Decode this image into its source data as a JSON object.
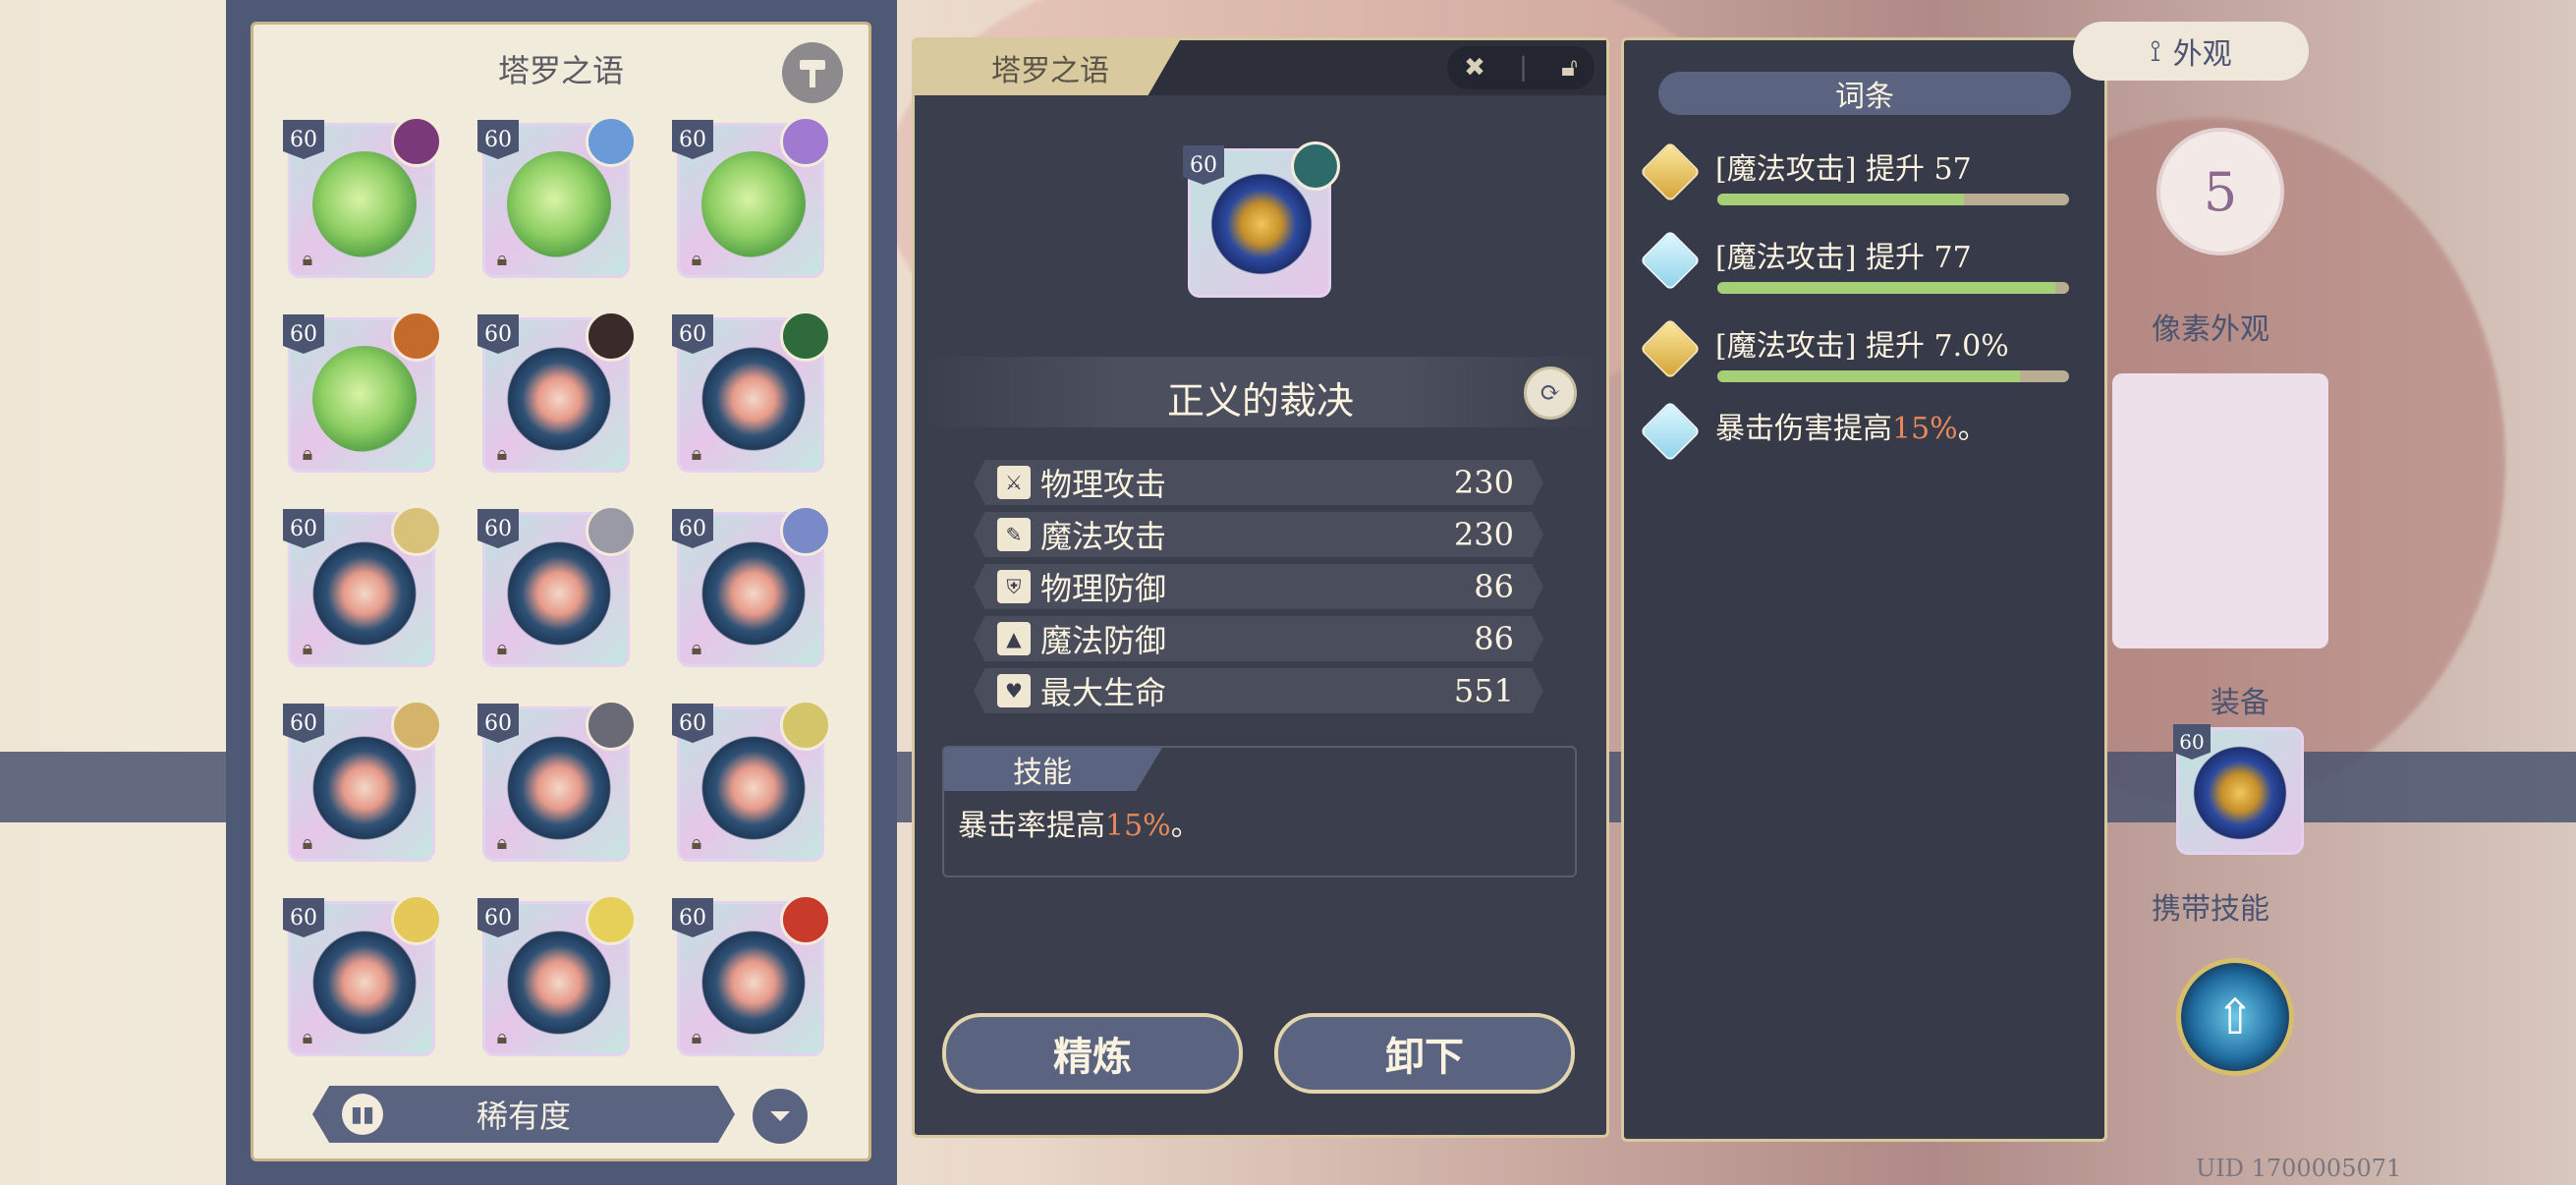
{
  "inventory": {
    "title": "塔罗之语",
    "sort_label": "稀有度",
    "cards": [
      {
        "level": "60",
        "art": "green",
        "owner_color": "#7a3a7a"
      },
      {
        "level": "60",
        "art": "green",
        "owner_color": "#6a9ad8"
      },
      {
        "level": "60",
        "art": "green",
        "owner_color": "#a07ad0"
      },
      {
        "level": "60",
        "art": "green",
        "owner_color": "#c46a2a"
      },
      {
        "level": "60",
        "art": "blue",
        "owner_color": "#3a2a2a"
      },
      {
        "level": "60",
        "art": "blue",
        "owner_color": "#2f6a3a"
      },
      {
        "level": "60",
        "art": "blue",
        "owner_color": "#d8c27a"
      },
      {
        "level": "60",
        "art": "blue",
        "owner_color": "#9a9aa6"
      },
      {
        "level": "60",
        "art": "blue",
        "owner_color": "#7a8ac8"
      },
      {
        "level": "60",
        "art": "blue",
        "owner_color": "#d4b46a"
      },
      {
        "level": "60",
        "art": "blue",
        "owner_color": "#6a6a76"
      },
      {
        "level": "60",
        "art": "blue",
        "owner_color": "#d4c46a"
      },
      {
        "level": "60",
        "art": "blue",
        "owner_color": "#e6c85a"
      },
      {
        "level": "60",
        "art": "blue",
        "owner_color": "#e6d05a"
      },
      {
        "level": "60",
        "art": "blue",
        "owner_color": "#c83a2a"
      }
    ]
  },
  "detail": {
    "tab_title": "塔罗之语",
    "card_level": "60",
    "card_name": "正义的裁决",
    "stats": [
      {
        "label": "物理攻击",
        "value": "230",
        "icon": "sword-icon",
        "glyph": "⚔"
      },
      {
        "label": "魔法攻击",
        "value": "230",
        "icon": "wand-icon",
        "glyph": "✎"
      },
      {
        "label": "物理防御",
        "value": "86",
        "icon": "shield-icon",
        "glyph": "⛨"
      },
      {
        "label": "魔法防御",
        "value": "86",
        "icon": "wizard-hat-icon",
        "glyph": "▲"
      },
      {
        "label": "最大生命",
        "value": "551",
        "icon": "heart-icon",
        "glyph": "♥"
      }
    ],
    "skill_tab": "技能",
    "skill_desc_before": "暴击率提高",
    "skill_desc_highlight": "15%",
    "skill_desc_after": "。",
    "refine_button": "精炼",
    "unequip_button": "卸下"
  },
  "affix": {
    "title": "词条",
    "rows": [
      {
        "text": "[魔法攻击] 提升 57",
        "gem": "gold",
        "fill": 0.7
      },
      {
        "text": "[魔法攻击] 提升 77",
        "gem": "cyan",
        "fill": 0.96
      },
      {
        "text": "[魔法攻击] 提升 7.0%",
        "gem": "gold",
        "fill": 0.86
      }
    ],
    "extra_before": "暴击伤害提高",
    "extra_highlight": "15%",
    "extra_after": "。"
  },
  "side": {
    "appearance_button": "外观",
    "rank": "5",
    "pixel_label": "像素外观",
    "equip_label": "装备",
    "equip_level": "60",
    "skill_label": "携带技能",
    "uid": "UID 1700005071"
  },
  "colors": {
    "accent_orange": "#e68a5e",
    "panel_dark": "#3b3e4c",
    "gold_border": "#d9c99e",
    "bar_fill": "#a6cf78"
  }
}
